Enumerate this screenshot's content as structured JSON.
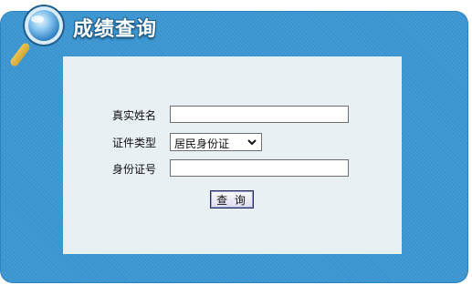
{
  "header": {
    "title": "成绩查询"
  },
  "form": {
    "name_label": "真实姓名",
    "name_value": "",
    "id_type_label": "证件类型",
    "id_type_selected": "居民身份证",
    "id_number_label": "身份证号",
    "id_number_value": "",
    "query_button": "查 询"
  },
  "icons": {
    "magnifier": "magnifier-icon",
    "dropdown": "chevron-down-icon"
  },
  "colors": {
    "panel": "#3a94cf",
    "form_background": "#e8f0f4",
    "title_text": "#ffffff"
  }
}
